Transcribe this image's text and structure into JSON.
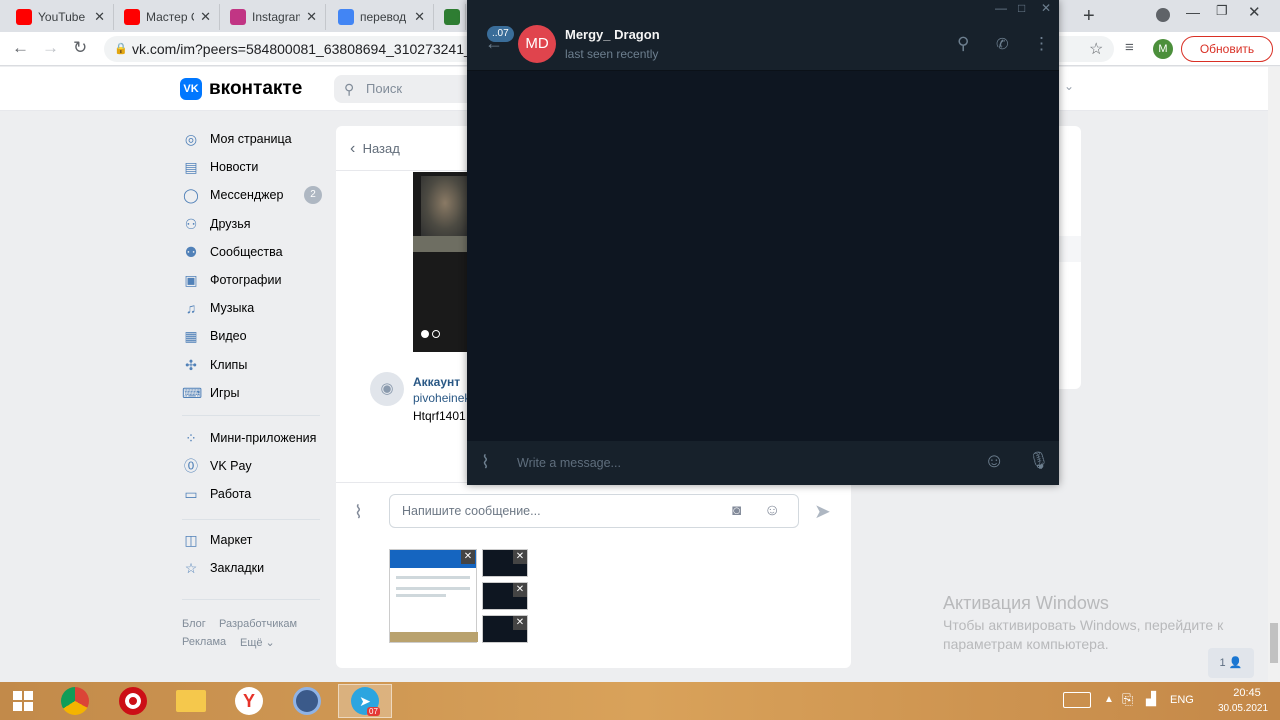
{
  "browser": {
    "tabs": [
      {
        "title": "YouTube",
        "color": "#ff0000"
      },
      {
        "title": "Мастер С",
        "color": "#ff0000"
      },
      {
        "title": "Instagram",
        "color": "#c13584"
      },
      {
        "title": "перевод",
        "color": "#4285f4"
      },
      {
        "title": "",
        "color": "#2e7d32"
      }
    ],
    "url": "vk.com/im?peers=584800081_63808694_310273241_4611",
    "update_label": "Обновить",
    "profile_initial": "M",
    "new_tab": "+"
  },
  "vk": {
    "logo_text": "вконтакте",
    "logo_mark": "VK",
    "search_placeholder": "Поиск",
    "menu": [
      {
        "label": "Моя страница",
        "icon": "profile-icon"
      },
      {
        "label": "Новости",
        "icon": "news-icon"
      },
      {
        "label": "Мессенджер",
        "icon": "messenger-icon"
      },
      {
        "label": "Друзья",
        "icon": "friends-icon"
      },
      {
        "label": "Сообщества",
        "icon": "communities-icon"
      },
      {
        "label": "Фотографии",
        "icon": "photos-icon"
      },
      {
        "label": "Музыка",
        "icon": "music-icon"
      },
      {
        "label": "Видео",
        "icon": "video-icon"
      },
      {
        "label": "Клипы",
        "icon": "clips-icon"
      },
      {
        "label": "Игры",
        "icon": "games-icon"
      }
    ],
    "menu2": [
      {
        "label": "Мини-приложения",
        "icon": "mini-apps-icon"
      },
      {
        "label": "VK Pay",
        "icon": "vk-pay-icon"
      },
      {
        "label": "Работа",
        "icon": "work-icon"
      }
    ],
    "menu3": [
      {
        "label": "Маркет",
        "icon": "market-icon"
      },
      {
        "label": "Закладки",
        "icon": "bookmarks-icon"
      }
    ],
    "messenger_badge": "2",
    "footer": [
      "Блог",
      "Разработчикам",
      "Реклама",
      "Ещё ⌄"
    ],
    "chat": {
      "back_label": "Назад",
      "sender": "Аккаунт",
      "line1": "pivoheinek",
      "line2": "Htqrf1401",
      "composer_placeholder": "Напишите сообщение..."
    },
    "online_count": "1"
  },
  "telegram": {
    "contact_name": "Mergy_ Dragon",
    "contact_initials": "MD",
    "status": "last seen recently",
    "unread_badge": "..07",
    "input_placeholder": "Write a message..."
  },
  "watermark": {
    "title": "Активация Windows",
    "body": "Чтобы активировать Windows, перейдите к параметрам компьютера."
  },
  "taskbar": {
    "lang": "ENG",
    "time": "20:45",
    "date": "30.05.2021",
    "tg_badge": "07"
  }
}
